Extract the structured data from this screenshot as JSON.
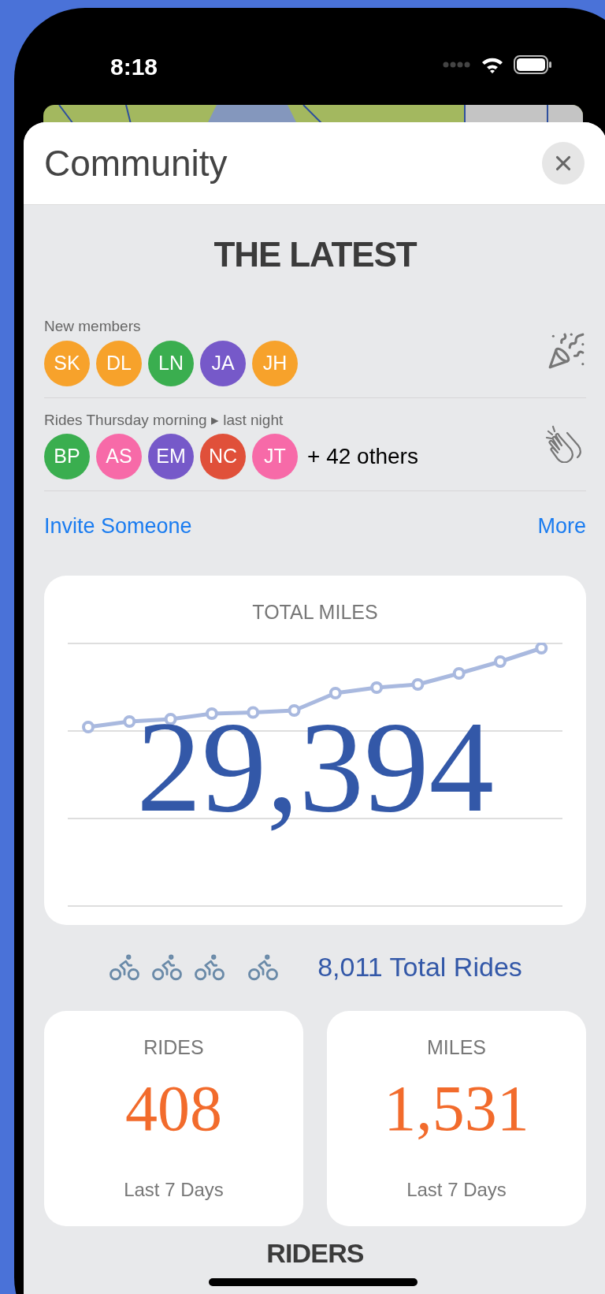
{
  "status_bar": {
    "time": "8:18"
  },
  "sheet": {
    "title": "Community"
  },
  "latest": {
    "heading": "THE LATEST",
    "groups": [
      {
        "kind": "party",
        "label": "New members",
        "avatars": [
          {
            "initials": "SK",
            "color": "#f7a22b"
          },
          {
            "initials": "DL",
            "color": "#f7a22b"
          },
          {
            "initials": "LN",
            "color": "#3aae4f"
          },
          {
            "initials": "JA",
            "color": "#7659c9"
          },
          {
            "initials": "JH",
            "color": "#f7a22b"
          }
        ]
      },
      {
        "kind": "clap",
        "label": "Rides Thursday morning ▸ last night",
        "avatars": [
          {
            "initials": "BP",
            "color": "#3aae4f"
          },
          {
            "initials": "AS",
            "color": "#f76aa8"
          },
          {
            "initials": "EM",
            "color": "#7659c9"
          },
          {
            "initials": "NC",
            "color": "#e0503a"
          },
          {
            "initials": "JT",
            "color": "#f76aa8"
          }
        ],
        "extra": "+ 42 others"
      }
    ],
    "links": [
      "Invite Someone",
      "More"
    ]
  },
  "total_miles": {
    "title": "TOTAL MILES",
    "value": "29,394"
  },
  "total_rides": {
    "text": "8,011 Total Rides"
  },
  "stat_cards": [
    {
      "label": "RIDES",
      "value": "408",
      "period": "Last 7 Days"
    },
    {
      "label": "MILES",
      "value": "1,531",
      "period": "Last 7 Days"
    }
  ],
  "next_heading": "RIDERS"
}
